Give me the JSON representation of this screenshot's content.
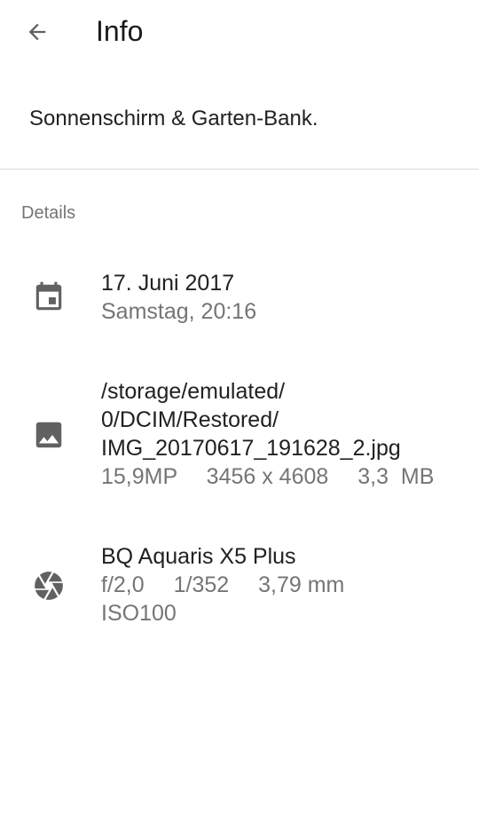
{
  "header": {
    "back_icon": "arrow-back-icon",
    "title": "Info"
  },
  "description": "Sonnenschirm & Garten-Bank.",
  "details": {
    "section_label": "Details",
    "date": {
      "icon": "calendar-icon",
      "date": "17. Juni 2017",
      "day_time": "Samstag, 20:16"
    },
    "file": {
      "icon": "image-icon",
      "path_line1": "/storage/emulated/",
      "path_line2": "0/DCIM/Restored/",
      "path_line3": "IMG_20170617_191628_2.jpg",
      "megapixels": "15,9MP",
      "resolution": "3456 x 4608",
      "size": "3,3  MB"
    },
    "camera": {
      "icon": "aperture-icon",
      "model": "BQ Aquaris X5 Plus",
      "aperture": "f/2,0",
      "exposure": "1/352",
      "focal_length": "3,79 mm",
      "iso": "ISO100"
    }
  },
  "colors": {
    "primary_text": "#212121",
    "secondary_text": "#757575",
    "icon": "#616161",
    "divider": "#dcdcdc"
  }
}
